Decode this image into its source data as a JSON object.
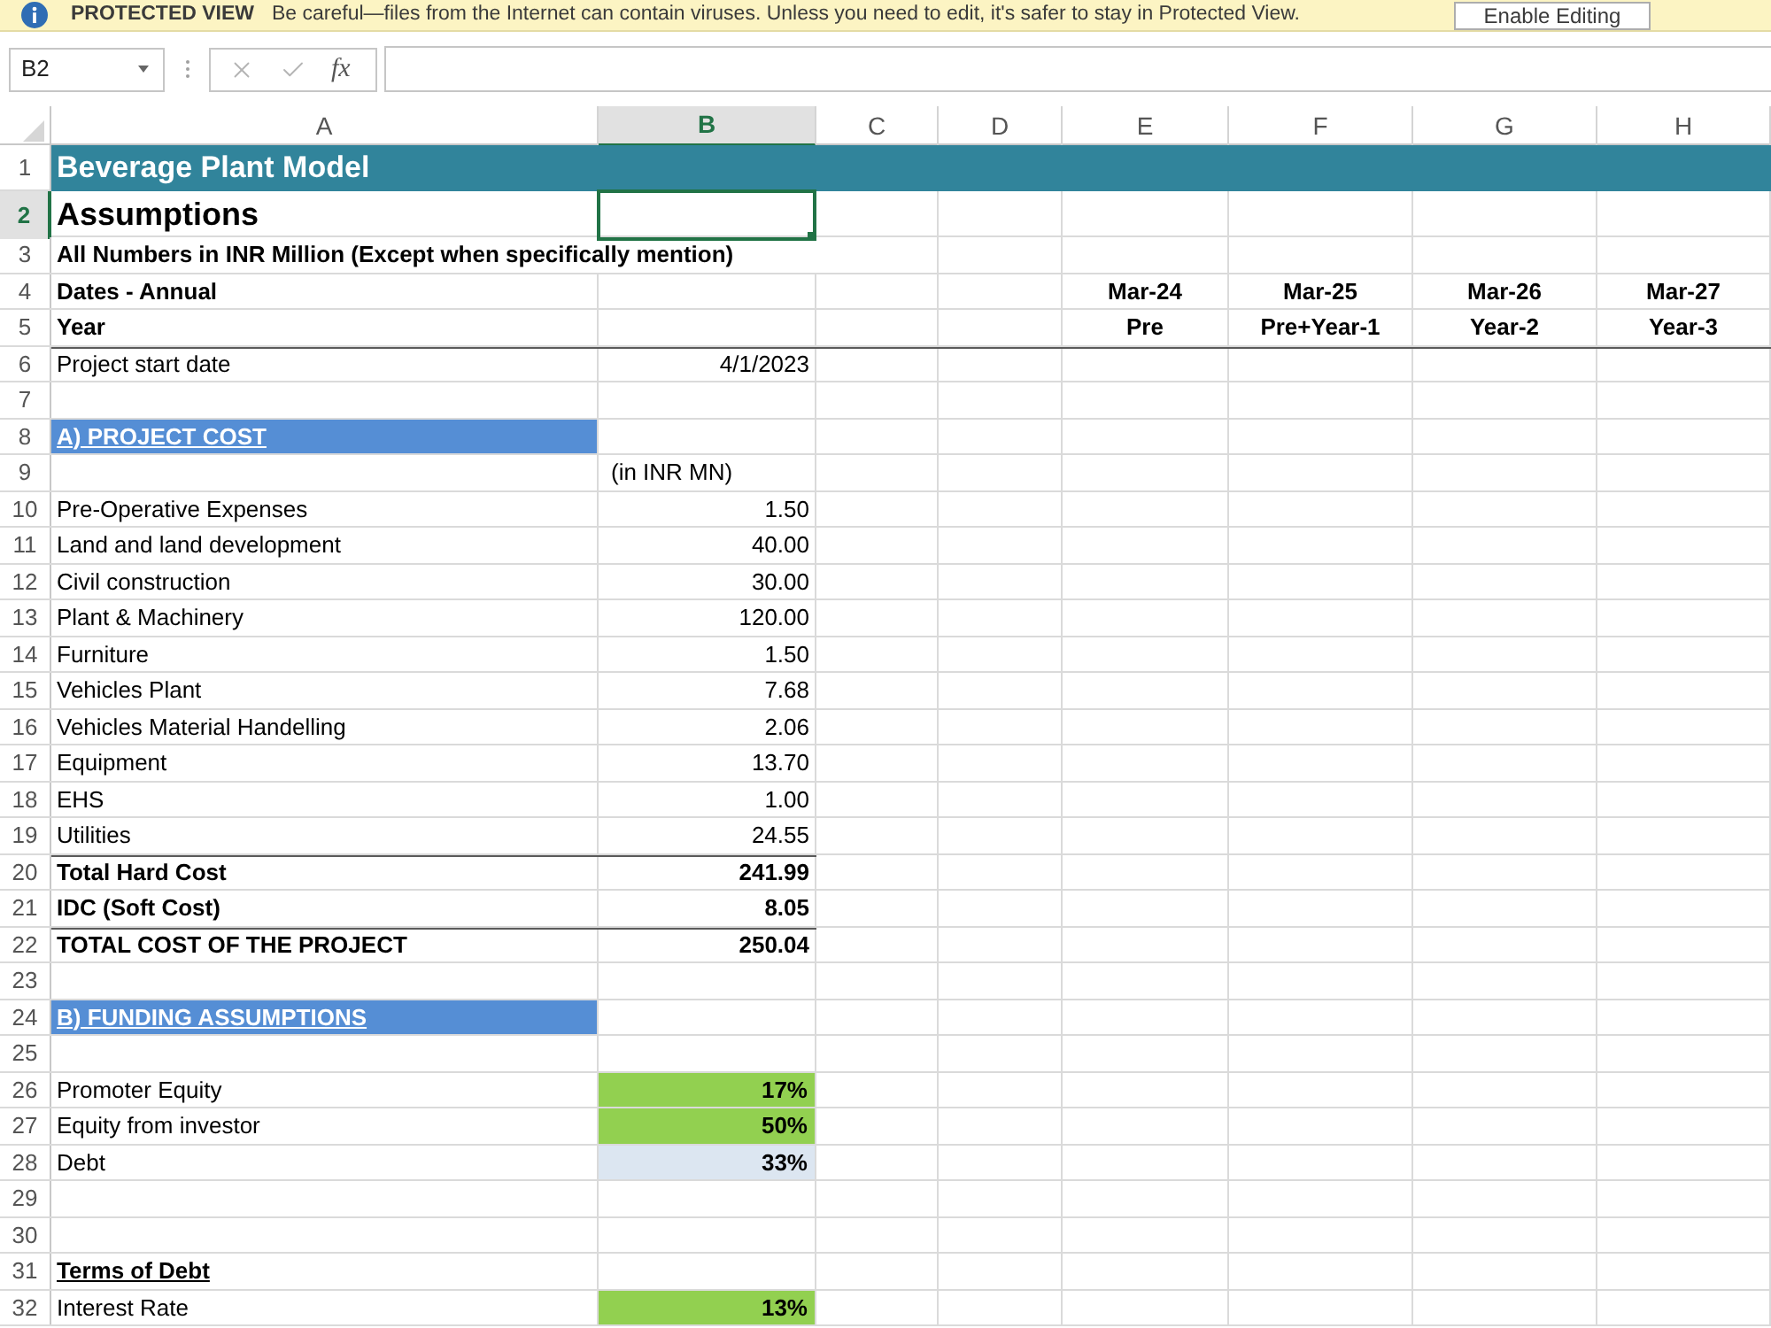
{
  "protected_view": {
    "title": "PROTECTED VIEW",
    "message": "Be careful—files from the Internet can contain viruses. Unless you need to edit, it's safer to stay in Protected View.",
    "button": "Enable Editing"
  },
  "formula_bar": {
    "name_box": "B2",
    "function_label": "fx"
  },
  "columns": [
    {
      "letter": "A",
      "selected": false
    },
    {
      "letter": "B",
      "selected": true
    },
    {
      "letter": "C",
      "selected": false
    },
    {
      "letter": "D",
      "selected": false
    },
    {
      "letter": "E",
      "selected": false
    },
    {
      "letter": "F",
      "selected": false
    },
    {
      "letter": "G",
      "selected": false
    },
    {
      "letter": "H",
      "selected": false
    }
  ],
  "rows": [
    {
      "number": "1",
      "kind": "banner",
      "selected": false,
      "rule_above": false,
      "a": "Beverage Plant Model"
    },
    {
      "number": "2",
      "kind": "heading",
      "selected": true,
      "rule_above": false,
      "a": "Assumptions"
    },
    {
      "number": "3",
      "kind": "note",
      "selected": false,
      "rule_above": false,
      "a": "All Numbers in INR Million (Except when specifically mention)"
    },
    {
      "number": "4",
      "kind": "bold",
      "selected": false,
      "rule_above": false,
      "a": "Dates - Annual",
      "periods": [
        "Mar-24",
        "Mar-25",
        "Mar-26",
        "Mar-27"
      ]
    },
    {
      "number": "5",
      "kind": "bold",
      "selected": false,
      "rule_above": false,
      "a": "Year",
      "periods": [
        "Pre",
        "Pre+Year-1",
        "Year-2",
        "Year-3"
      ]
    },
    {
      "number": "6",
      "kind": "plain",
      "selected": false,
      "rule_above": true,
      "a": "Project start date",
      "b": "4/1/2023"
    },
    {
      "number": "7",
      "kind": "plain",
      "selected": false,
      "rule_above": false
    },
    {
      "number": "8",
      "kind": "section",
      "selected": false,
      "rule_above": false,
      "a": "A) PROJECT COST"
    },
    {
      "number": "9",
      "kind": "unit",
      "selected": false,
      "rule_above": false,
      "b": "(in INR MN)"
    },
    {
      "number": "10",
      "kind": "plain",
      "selected": false,
      "rule_above": false,
      "a": "Pre-Operative Expenses",
      "b": "1.50"
    },
    {
      "number": "11",
      "kind": "plain",
      "selected": false,
      "rule_above": false,
      "a": "Land and land development",
      "b": "40.00"
    },
    {
      "number": "12",
      "kind": "plain",
      "selected": false,
      "rule_above": false,
      "a": "Civil construction",
      "b": "30.00"
    },
    {
      "number": "13",
      "kind": "plain",
      "selected": false,
      "rule_above": false,
      "a": "Plant & Machinery",
      "b": "120.00"
    },
    {
      "number": "14",
      "kind": "plain",
      "selected": false,
      "rule_above": false,
      "a": "Furniture",
      "b": "1.50"
    },
    {
      "number": "15",
      "kind": "plain",
      "selected": false,
      "rule_above": false,
      "a": "Vehicles Plant",
      "b": "7.68"
    },
    {
      "number": "16",
      "kind": "plain",
      "selected": false,
      "rule_above": false,
      "a": "Vehicles Material Handelling",
      "b": "2.06"
    },
    {
      "number": "17",
      "kind": "plain",
      "selected": false,
      "rule_above": false,
      "a": "Equipment",
      "b": "13.70"
    },
    {
      "number": "18",
      "kind": "plain",
      "selected": false,
      "rule_above": false,
      "a": "EHS",
      "b": "1.00"
    },
    {
      "number": "19",
      "kind": "plain",
      "selected": false,
      "rule_above": false,
      "a": "Utilities",
      "b": "24.55"
    },
    {
      "number": "20",
      "kind": "total",
      "selected": false,
      "rule_above": true,
      "a": "Total Hard Cost",
      "b": "241.99"
    },
    {
      "number": "21",
      "kind": "bold",
      "selected": false,
      "rule_above": false,
      "a": "IDC (Soft Cost)",
      "b": "8.05"
    },
    {
      "number": "22",
      "kind": "total",
      "selected": false,
      "rule_above": true,
      "a": "TOTAL COST OF THE PROJECT",
      "b": "250.04"
    },
    {
      "number": "23",
      "kind": "plain",
      "selected": false,
      "rule_above": false
    },
    {
      "number": "24",
      "kind": "section",
      "selected": false,
      "rule_above": false,
      "a": "B) FUNDING ASSUMPTIONS"
    },
    {
      "number": "25",
      "kind": "plain",
      "selected": false,
      "rule_above": false
    },
    {
      "number": "26",
      "kind": "input",
      "selected": false,
      "rule_above": false,
      "a": "Promoter Equity",
      "b": "17%",
      "color": "#92d050"
    },
    {
      "number": "27",
      "kind": "input",
      "selected": false,
      "rule_above": false,
      "a": "Equity from investor",
      "b": "50%",
      "color": "#92d050"
    },
    {
      "number": "28",
      "kind": "input",
      "selected": false,
      "rule_above": false,
      "a": "Debt",
      "b": "33%",
      "color": "#dce6f1"
    },
    {
      "number": "29",
      "kind": "plain",
      "selected": false,
      "rule_above": false
    },
    {
      "number": "30",
      "kind": "plain",
      "selected": false,
      "rule_above": false
    },
    {
      "number": "31",
      "kind": "subheading",
      "selected": false,
      "rule_above": false,
      "a": "Terms of Debt"
    },
    {
      "number": "32",
      "kind": "input",
      "selected": false,
      "rule_above": false,
      "a": "Interest Rate",
      "b": "13%",
      "color": "#92d050"
    }
  ]
}
